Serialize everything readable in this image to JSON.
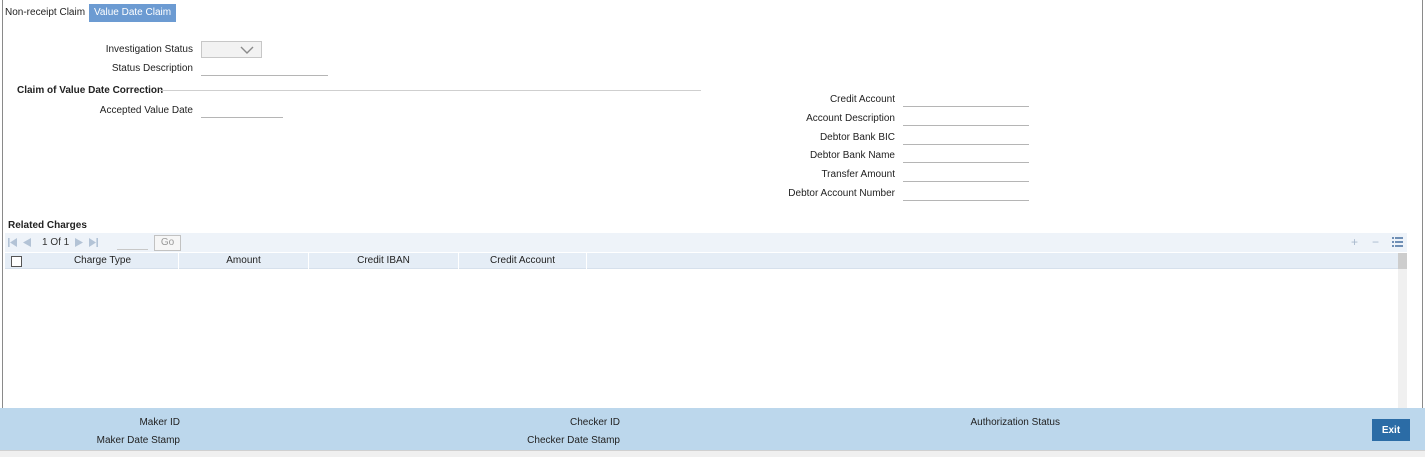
{
  "tabs": [
    {
      "label": "Non-receipt Claim",
      "active": false
    },
    {
      "label": "Value Date Claim",
      "active": true
    }
  ],
  "investigation": {
    "status_label": "Investigation Status",
    "status_value": "",
    "description_label": "Status Description",
    "description_value": ""
  },
  "claim_section": {
    "title": "Claim of Value Date Correction",
    "accepted_value_date_label": "Accepted Value Date",
    "accepted_value_date_value": ""
  },
  "right_fields": [
    {
      "label": "Credit Account",
      "value": ""
    },
    {
      "label": "Account Description",
      "value": ""
    },
    {
      "label": "Debtor Bank BIC",
      "value": ""
    },
    {
      "label": "Debtor Bank Name",
      "value": ""
    },
    {
      "label": "Transfer Amount",
      "value": ""
    },
    {
      "label": "Debtor Account Number",
      "value": ""
    }
  ],
  "related_charges": {
    "title": "Related Charges",
    "pagination": {
      "text": "1 Of 1",
      "go_label": "Go"
    },
    "columns": [
      "Charge Type",
      "Amount",
      "Credit IBAN",
      "Credit Account"
    ],
    "rows": []
  },
  "footer": {
    "maker_id_label": "Maker ID",
    "maker_date_label": "Maker Date Stamp",
    "checker_id_label": "Checker ID",
    "checker_date_label": "Checker Date Stamp",
    "auth_status_label": "Authorization Status",
    "exit_label": "Exit"
  },
  "colors": {
    "active_tab": "#6c9bd2",
    "footer_bg": "#bcd7ec",
    "exit_button": "#2b6ca6",
    "grid_header": "#e5edf6"
  },
  "icons": {
    "first_page": "first-page-icon",
    "prev_page": "prev-page-icon",
    "next_page": "next-page-icon",
    "last_page": "last-page-icon",
    "add_row": "plus-icon",
    "delete_row": "minus-icon",
    "single_view": "list-view-icon",
    "dropdown": "chevron-down-icon"
  }
}
